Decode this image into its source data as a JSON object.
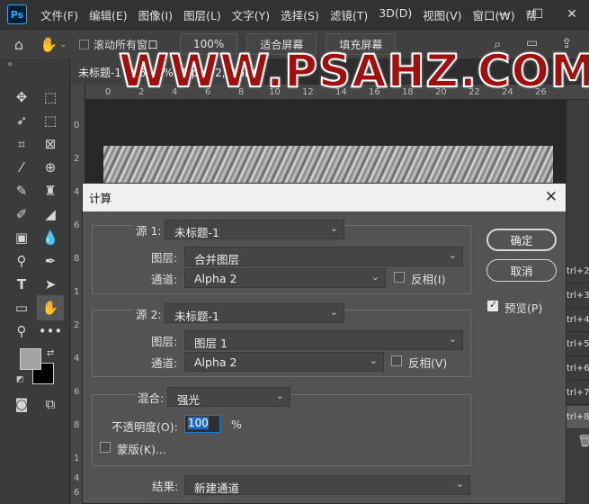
{
  "menubar": {
    "logo": "Ps",
    "items": [
      "文件(F)",
      "编辑(E)",
      "图像(I)",
      "图层(L)",
      "文字(Y)",
      "选择(S)",
      "滤镜(T)",
      "3D(D)",
      "视图(V)",
      "窗口(W)",
      "帮"
    ],
    "window_controls": [
      "—",
      "☐",
      "✕"
    ]
  },
  "options_bar": {
    "scroll_all_label": "滚动所有窗口",
    "zoom_value": "100%",
    "fit_screen": "适合屏幕",
    "fill_screen": "填充屏幕"
  },
  "document": {
    "tab_title": "未标题-1 @ 66.7% (Alpha 2, RGB/8#) *",
    "ruler_top": [
      "0",
      "2",
      "4",
      "6",
      "8",
      "10",
      "12",
      "14",
      "16",
      "18",
      "20",
      "22",
      "24",
      "26"
    ],
    "ruler_left": [
      "0",
      "2",
      "4",
      "6",
      "8",
      "1",
      "2",
      "4",
      "6",
      "8",
      "1",
      "4",
      "6"
    ]
  },
  "watermark": "WWW.PSAHZ.COM",
  "channels_panel": {
    "shortcuts": [
      "trl+2",
      "trl+3",
      "trl+4",
      "trl+5",
      "trl+6",
      "trl+7",
      "trl+8"
    ]
  },
  "dialog": {
    "title": "计算",
    "source1": {
      "label": "源 1:",
      "value": "未标题-1",
      "layer_label": "图层:",
      "layer_value": "合并图层",
      "channel_label": "通道:",
      "channel_value": "Alpha 2",
      "invert_label": "反相(I)"
    },
    "source2": {
      "label": "源 2:",
      "value": "未标题-1",
      "layer_label": "图层:",
      "layer_value": "图层 1",
      "channel_label": "通道:",
      "channel_value": "Alpha 2",
      "invert_label": "反相(V)"
    },
    "blend": {
      "label": "混合:",
      "value": "强光",
      "opacity_label": "不透明度(O):",
      "opacity_value": "100",
      "opacity_unit": "%",
      "mask_label": "蒙版(K)..."
    },
    "result": {
      "label": "结果:",
      "value": "新建通道"
    },
    "ok": "确定",
    "cancel": "取消",
    "preview_label": "预览(P)",
    "preview_checked": true
  }
}
